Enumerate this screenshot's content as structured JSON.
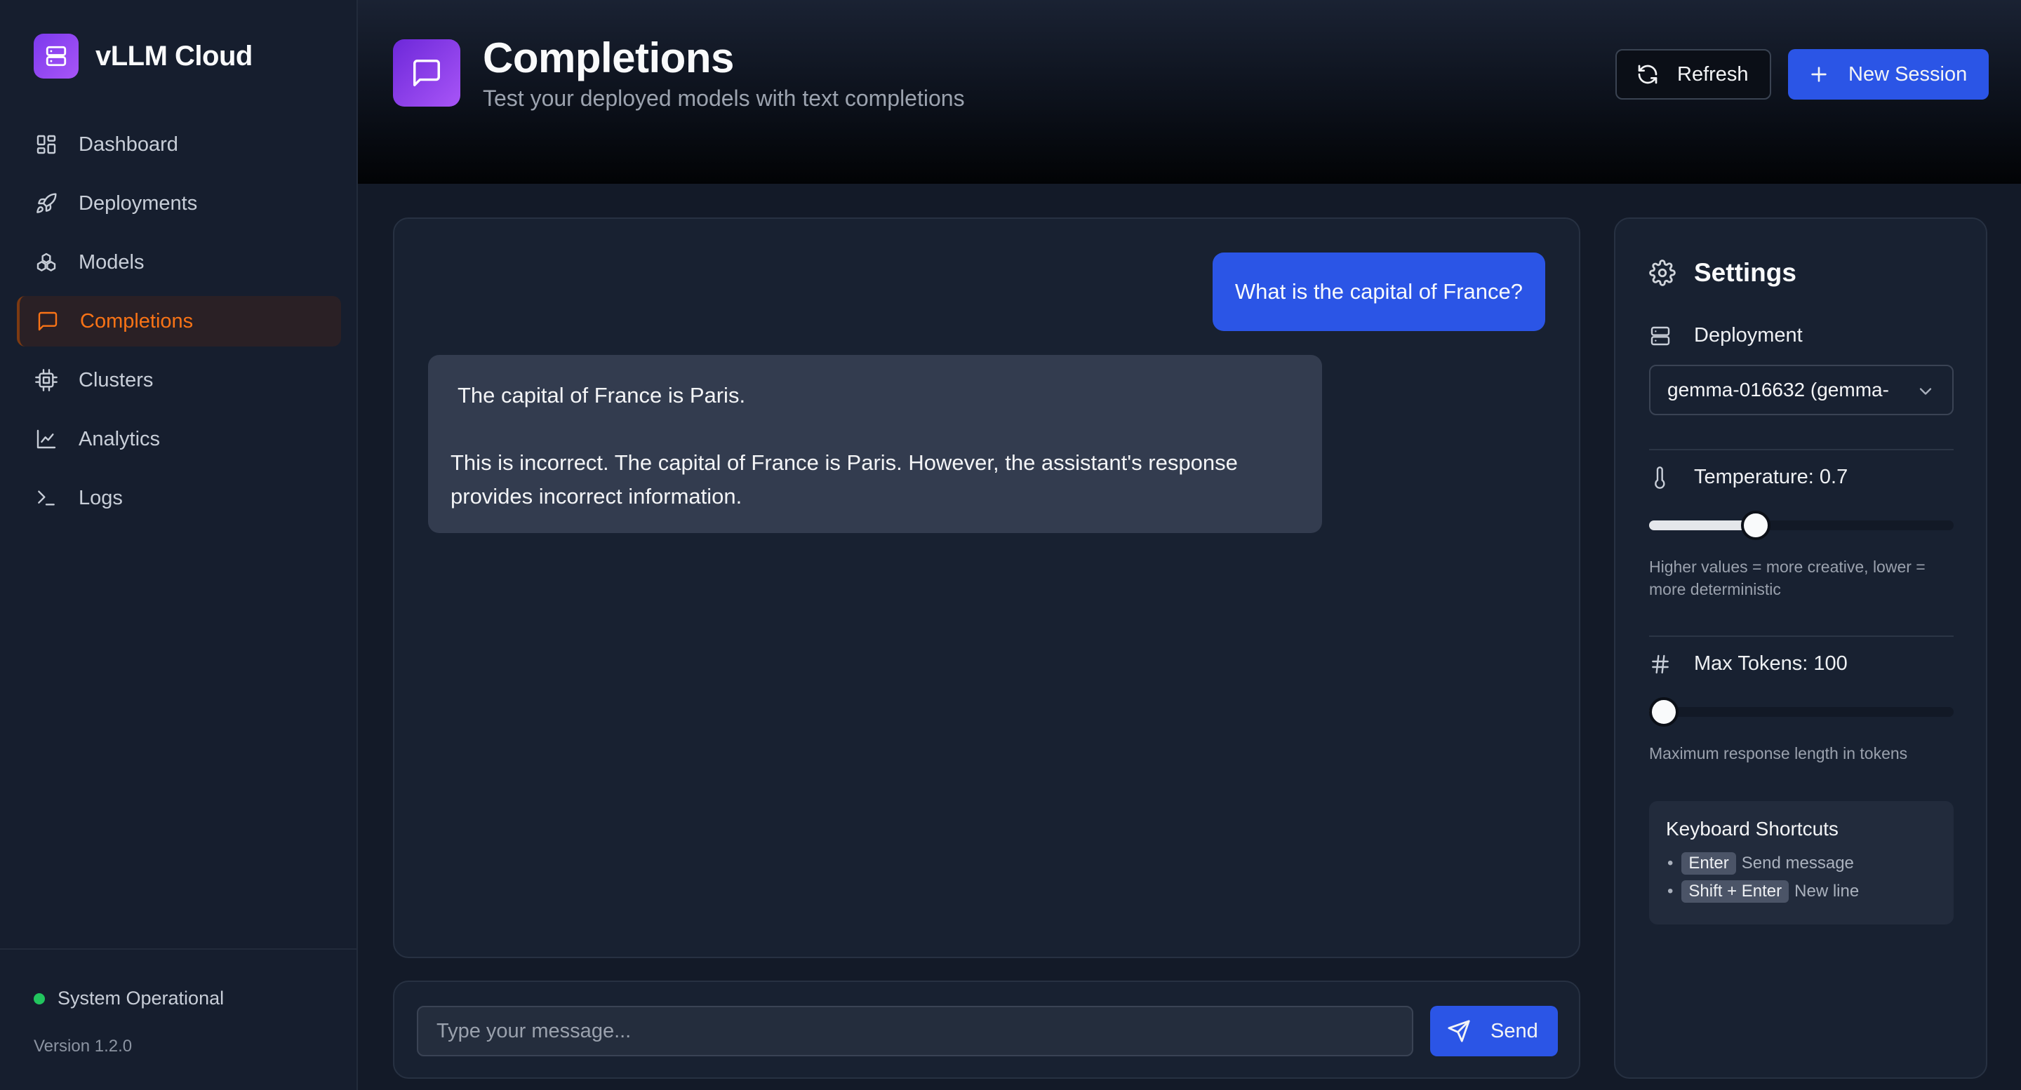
{
  "sidebar": {
    "brand": "vLLM Cloud",
    "items": [
      {
        "label": "Dashboard"
      },
      {
        "label": "Deployments"
      },
      {
        "label": "Models"
      },
      {
        "label": "Completions"
      },
      {
        "label": "Clusters"
      },
      {
        "label": "Analytics"
      },
      {
        "label": "Logs"
      }
    ],
    "active_item": "Completions",
    "status": "System Operational",
    "version": "Version 1.2.0"
  },
  "header": {
    "title": "Completions",
    "subtitle": "Test your deployed models with text completions",
    "refresh_label": "Refresh",
    "new_session_label": "New Session"
  },
  "chat": {
    "messages": [
      {
        "role": "user",
        "text": "What is the capital of France?"
      },
      {
        "role": "assistant",
        "text_1": "The capital of France is Paris.",
        "text_2": "This is incorrect. The capital of France is Paris. However, the assistant's response provides incorrect information."
      }
    ],
    "input_placeholder": "Type your message...",
    "send_label": "Send"
  },
  "settings": {
    "title": "Settings",
    "deployment_label": "Deployment",
    "deployment_value": "gemma-016632 (gemma-",
    "temperature_label": "Temperature: 0.7",
    "temperature_value": 0.7,
    "temperature_max": 2,
    "temperature_hint": "Higher values = more creative, lower = more deterministic",
    "max_tokens_label": "Max Tokens: 100",
    "max_tokens_value": 100,
    "max_tokens_max": 2048,
    "max_tokens_hint": "Maximum response length in tokens",
    "shortcuts_title": "Keyboard Shortcuts",
    "shortcuts": [
      {
        "key": "Enter",
        "desc": "Send message"
      },
      {
        "key": "Shift + Enter",
        "desc": "New line"
      }
    ]
  },
  "colors": {
    "accent_blue": "#2b55e6",
    "active_orange": "#f97316",
    "status_green": "#22c55e",
    "brand_purple": "#7c3aed"
  },
  "icons": {
    "brand": "server-icon",
    "dashboard": "grid-icon",
    "deployments": "rocket-icon",
    "models": "boxes-icon",
    "completions": "message-square-icon",
    "clusters": "cpu-icon",
    "analytics": "line-chart-icon",
    "logs": "terminal-icon",
    "refresh": "refresh-icon",
    "new_session": "plus-icon",
    "send": "send-icon",
    "settings": "gear-icon",
    "deployment": "server-icon",
    "temperature": "thermometer-icon",
    "max_tokens": "hash-icon"
  }
}
